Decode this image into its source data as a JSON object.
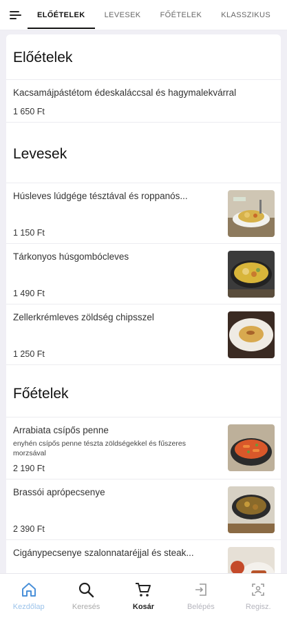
{
  "tabs": [
    {
      "label": "ELŐÉTELEK",
      "active": true
    },
    {
      "label": "LEVESEK",
      "active": false
    },
    {
      "label": "FŐÉTELEK",
      "active": false
    },
    {
      "label": "KLASSZIKUS",
      "active": false
    }
  ],
  "sections": {
    "eloetelek": {
      "title": "Előételek",
      "items": [
        {
          "name": "Kacsamájpástétom édeskaláccsal és hagymalekvárral",
          "price": "1 650 Ft"
        }
      ]
    },
    "levesek": {
      "title": "Levesek",
      "items": [
        {
          "name": "Húsleves lúdgége tésztával és roppanós...",
          "price": "1 150 Ft",
          "image": "soup-bowl-image"
        },
        {
          "name": "Tárkonyos húsgombócleves",
          "price": "1 490 Ft",
          "image": "soup-pot-image"
        },
        {
          "name": "Zellerkrémleves zöldség chipsszel",
          "price": "1 250 Ft",
          "image": "cream-soup-image"
        }
      ]
    },
    "foetelek": {
      "title": "Főételek",
      "items": [
        {
          "name": "Arrabiata csípős penne",
          "desc": "enyhén csípős penne tészta zöldségekkel és fűszeres morzsával",
          "price": "2 190 Ft",
          "image": "penne-image"
        },
        {
          "name": "Brassói aprópecsenye",
          "price": "2 390 Ft",
          "image": "brasso-image"
        },
        {
          "name": "Cigánypecsenye szalonnataréjjal és steak...",
          "price": "",
          "image": "roast-image"
        }
      ]
    }
  },
  "bottom_nav": [
    {
      "label": "Kezdőlap",
      "icon": "home-icon",
      "state": "active"
    },
    {
      "label": "Keresés",
      "icon": "search-icon",
      "state": "dim"
    },
    {
      "label": "Kosár",
      "icon": "cart-icon",
      "state": "bold"
    },
    {
      "label": "Belépés",
      "icon": "login-icon",
      "state": "dim"
    },
    {
      "label": "Regisz.",
      "icon": "register-icon",
      "state": "dim"
    }
  ],
  "colors": {
    "accent": "#9cc3ea",
    "background": "#f0eff5"
  }
}
